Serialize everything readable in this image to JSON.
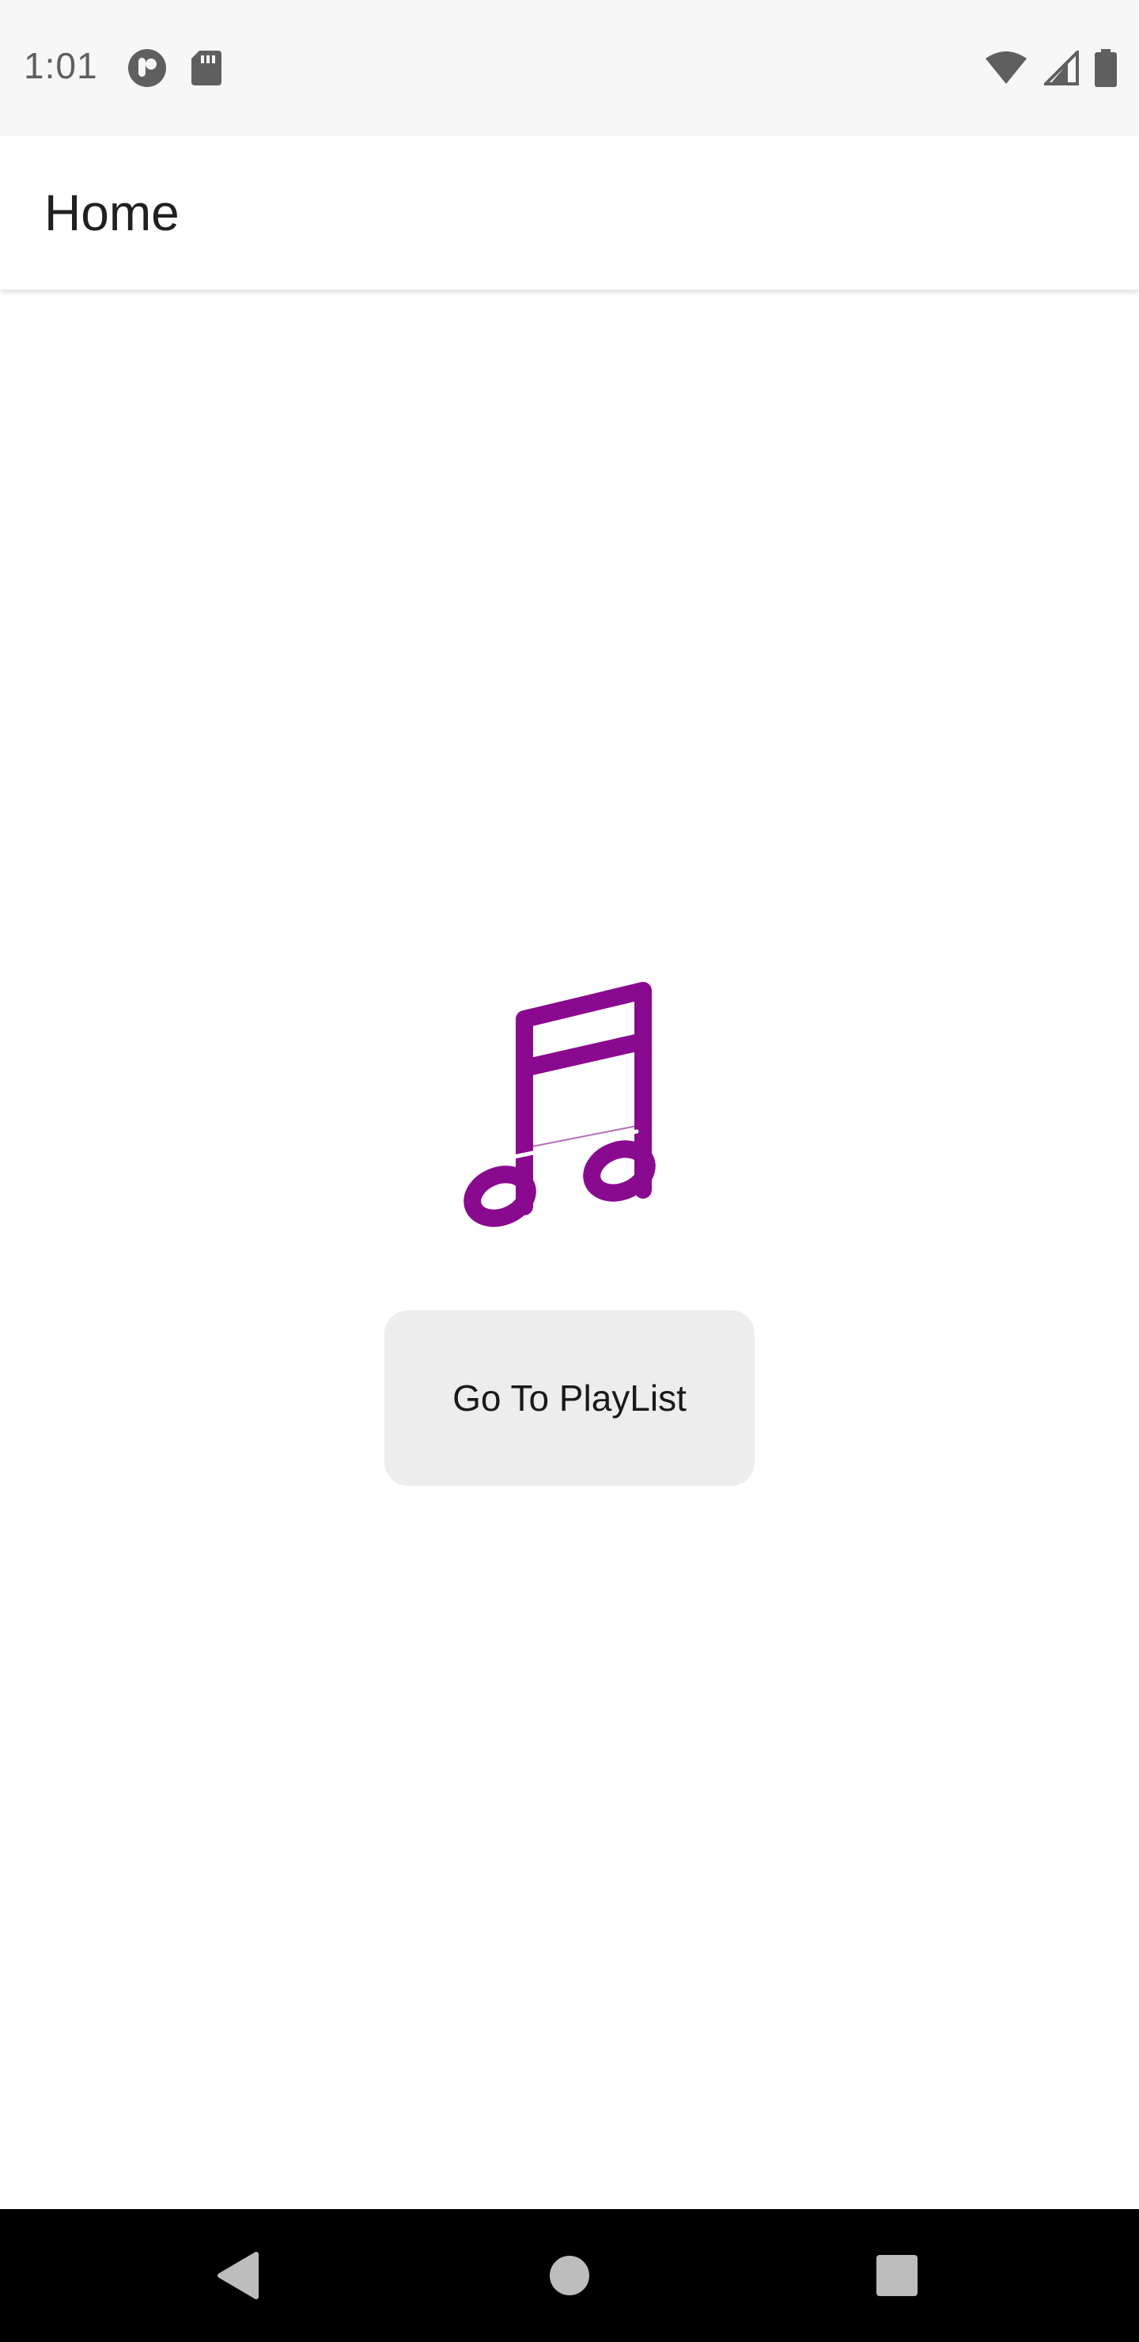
{
  "status_bar": {
    "time": "1:01",
    "left_icons": [
      "notification-app-icon",
      "sd-card-icon"
    ],
    "right_icons": [
      "wifi-icon",
      "cell-signal-icon",
      "battery-icon"
    ]
  },
  "app_bar": {
    "title": "Home"
  },
  "main": {
    "icon": "music-note-icon",
    "icon_color": "#8a0a8f",
    "button_label": "Go To PlayList"
  },
  "nav_bar": {
    "buttons": [
      "back-icon",
      "home-icon",
      "recents-icon"
    ]
  }
}
